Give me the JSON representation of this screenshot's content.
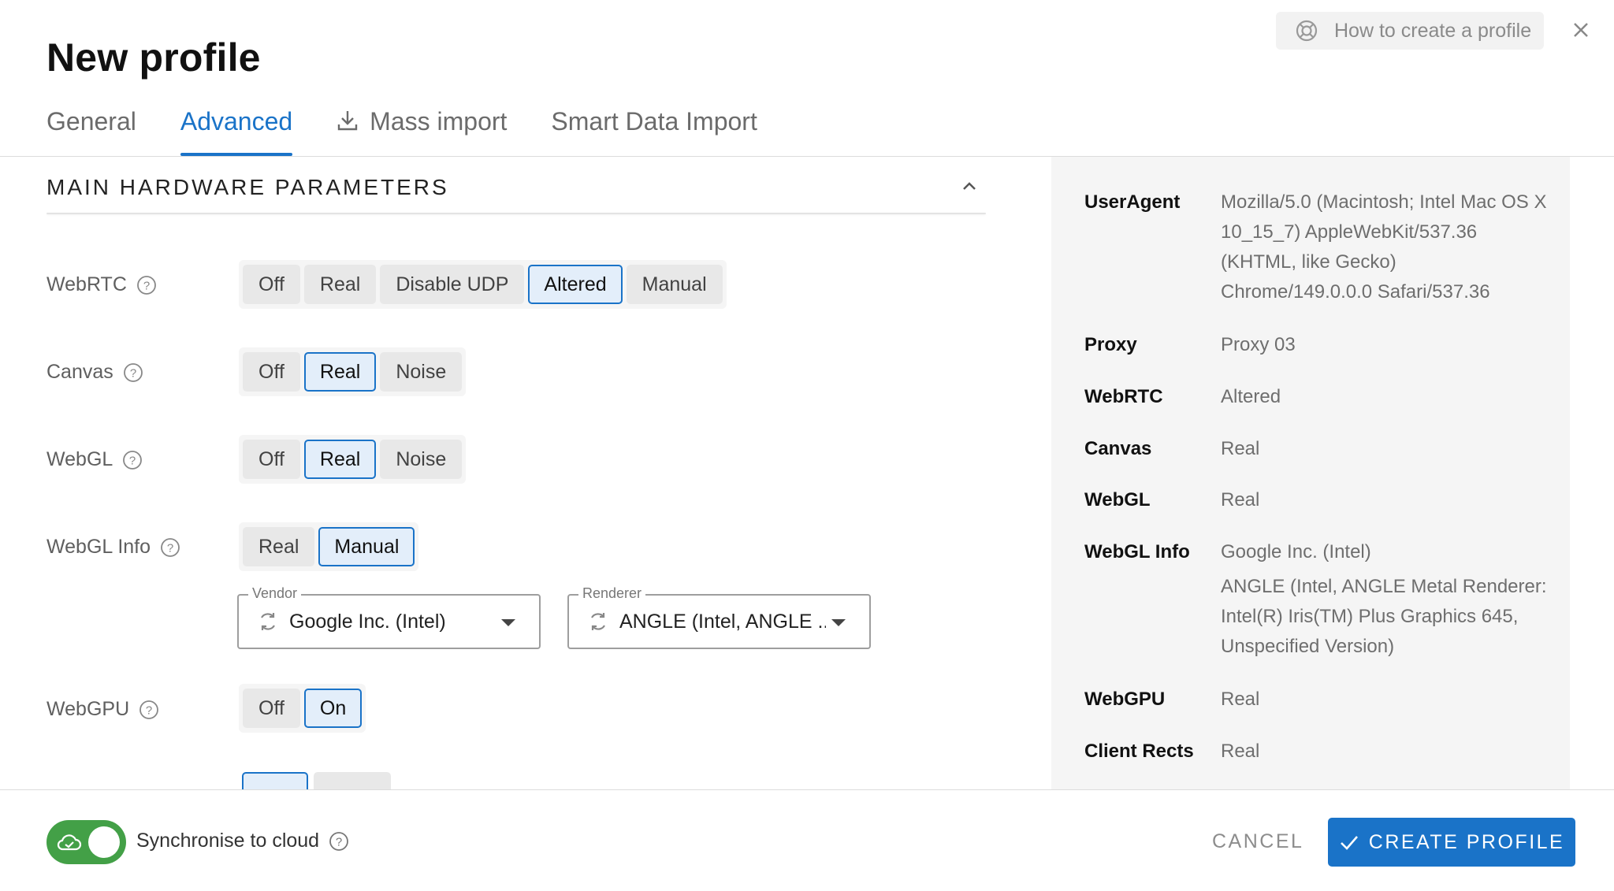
{
  "header": {
    "title": "New profile",
    "help_label": "How to create a profile"
  },
  "tabs": [
    {
      "label": "General",
      "active": false
    },
    {
      "label": "Advanced",
      "active": true
    },
    {
      "label": "Mass import",
      "active": false,
      "icon": "download-icon"
    },
    {
      "label": "Smart Data Import",
      "active": false
    }
  ],
  "section": {
    "title": "MAIN HARDWARE PARAMETERS"
  },
  "rows": {
    "webrtc": {
      "label": "WebRTC",
      "options": [
        "Off",
        "Real",
        "Disable UDP",
        "Altered",
        "Manual"
      ],
      "selected": "Altered"
    },
    "canvas": {
      "label": "Canvas",
      "options": [
        "Off",
        "Real",
        "Noise"
      ],
      "selected": "Real"
    },
    "webgl": {
      "label": "WebGL",
      "options": [
        "Off",
        "Real",
        "Noise"
      ],
      "selected": "Real"
    },
    "webgl_info": {
      "label": "WebGL Info",
      "options": [
        "Real",
        "Manual"
      ],
      "selected": "Manual"
    },
    "webgpu": {
      "label": "WebGPU",
      "options": [
        "Off",
        "On"
      ],
      "selected": "On"
    }
  },
  "vendor": {
    "legend": "Vendor",
    "value": "Google Inc. (Intel)"
  },
  "renderer": {
    "legend": "Renderer",
    "value": "ANGLE (Intel, ANGLE ..."
  },
  "summary": {
    "useragent": {
      "key": "UserAgent",
      "value": "Mozilla/5.0 (Macintosh; Intel Mac OS X 10_15_7) AppleWebKit/537.36 (KHTML, like Gecko) Chrome/149.0.0.0 Safari/537.36"
    },
    "proxy": {
      "key": "Proxy",
      "value": "Proxy 03"
    },
    "webrtc": {
      "key": "WebRTC",
      "value": "Altered"
    },
    "canvas": {
      "key": "Canvas",
      "value": "Real"
    },
    "webgl": {
      "key": "WebGL",
      "value": "Real"
    },
    "webgl_info": {
      "key": "WebGL Info",
      "value": "Google Inc. (Intel)",
      "value2": "ANGLE (Intel, ANGLE Metal Renderer: Intel(R) Iris(TM) Plus Graphics 645, Unspecified Version)"
    },
    "webgpu": {
      "key": "WebGPU",
      "value": "Real"
    },
    "client_rects": {
      "key": "Client Rects",
      "value": "Real"
    }
  },
  "footer": {
    "sync_label": "Synchronise to cloud",
    "sync_on": true,
    "cancel_label": "CANCEL",
    "create_label": "CREATE PROFILE"
  },
  "colors": {
    "accent": "#1a73c8",
    "toggle_on": "#43a047",
    "selected_bg": "#e3eefa"
  }
}
